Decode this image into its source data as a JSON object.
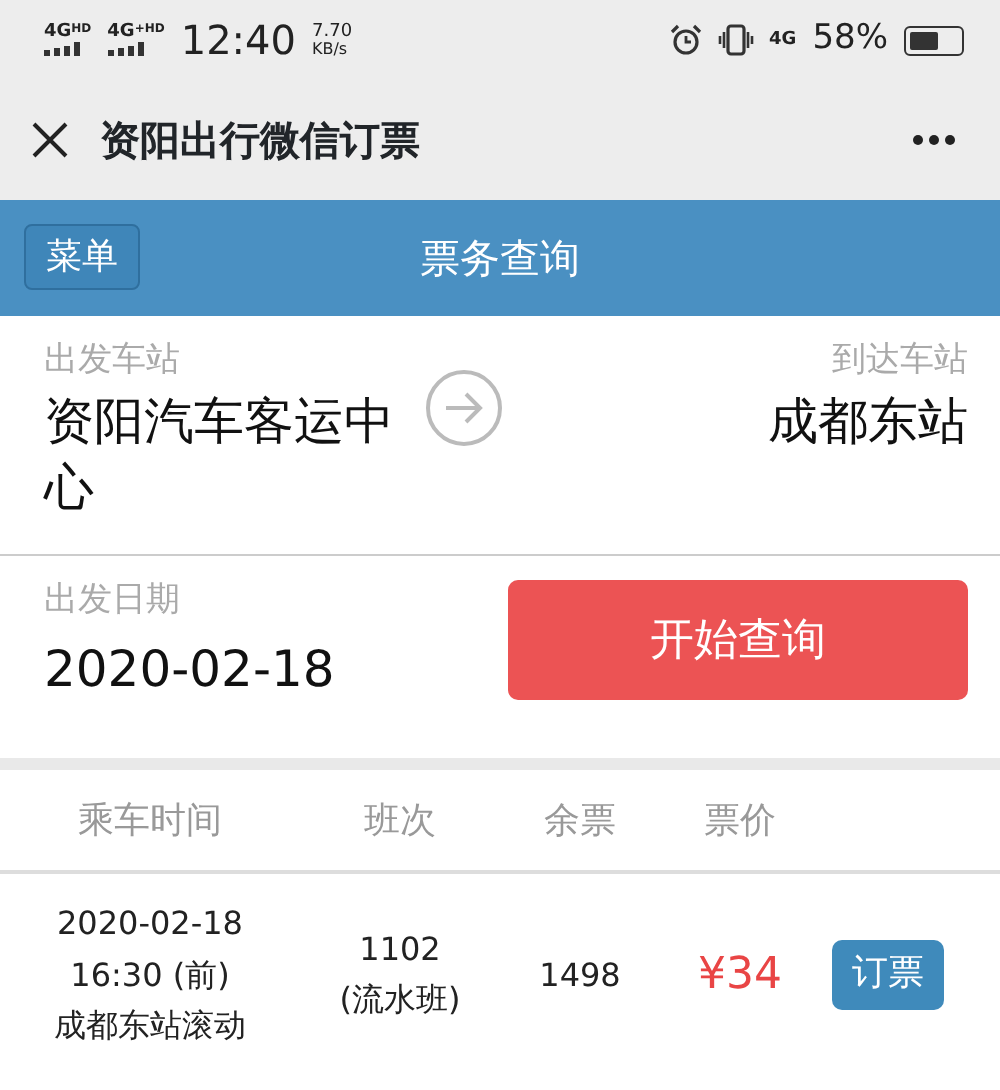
{
  "status_bar": {
    "signals": [
      {
        "label": "4G",
        "sup": "HD"
      },
      {
        "label": "4G",
        "sup": "+HD"
      }
    ],
    "time": "12:40",
    "speed": "7.70",
    "speed_unit": "KB/s",
    "data_label": "4G",
    "battery": "58%"
  },
  "window": {
    "title": "资阳出行微信订票"
  },
  "header": {
    "menu_button": "菜单",
    "title": "票务查询"
  },
  "route": {
    "from_label": "出发车站",
    "from": "资阳汽车客运中心",
    "to_label": "到达车站",
    "to": "成都东站"
  },
  "date": {
    "label": "出发日期",
    "value": "2020-02-18",
    "search_button": "开始查询"
  },
  "table": {
    "columns": [
      "乘车时间",
      "班次",
      "余票",
      "票价"
    ],
    "rows": [
      {
        "time": [
          "2020-02-18",
          "16:30 (前)",
          "成都东站滚动"
        ],
        "trip": [
          "1102",
          "(流水班)"
        ],
        "remaining": "1498",
        "price": "¥34",
        "button": "订票"
      }
    ]
  }
}
